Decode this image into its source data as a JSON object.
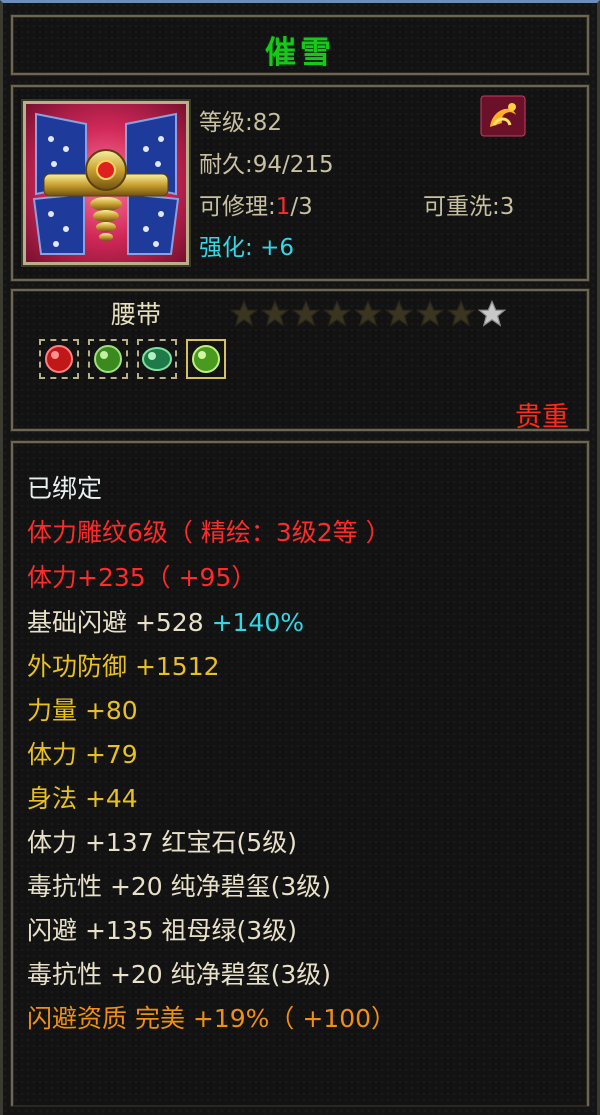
{
  "item": {
    "name": "催雪",
    "level_text": "等级:82",
    "durability_text": "耐久:94/215",
    "repair_label": "可修理:",
    "repair_used": "1",
    "repair_total": "/3",
    "rewash_text": "可重洗:3",
    "enhance_label": "强化: ",
    "enhance_value": "+6",
    "type": "腰带",
    "stars_total": 9,
    "stars_filled": 8,
    "rarity": "贵重"
  },
  "icons": {
    "item": "belt-item-icon",
    "skill": "skill-swirl-icon",
    "gems": [
      "red-gem-icon",
      "green-gem-icon",
      "green-gem-icon",
      "green-gem-icon"
    ]
  },
  "attributes": {
    "bound": "已绑定",
    "carve": "体力雕纹6级（ 精绘：3级2等 ）",
    "stamina_bonus": "体力+235（ +95）",
    "dodge_base_label": "基础闪避  +528",
    "dodge_base_pct": " +140%",
    "ext_defense": "外功防御  +1512",
    "strength": "力量  +80",
    "stamina": "体力  +79",
    "agility": "身法  +44",
    "gem_stat_1": "体力  +137  红宝石(5级)",
    "gem_stat_2": "毒抗性  +20  纯净碧玺(3级)",
    "gem_stat_3": "闪避  +135  祖母绿(3级)",
    "gem_stat_4": "毒抗性  +20  纯净碧玺(3级)",
    "aptitude": "闪避资质    完美  +19%（ +100）"
  },
  "colors": {
    "title": "#18c818",
    "label": "#c8c0a0",
    "cyan": "#30d8e8",
    "red": "#ff2a2a",
    "gold": "#e8c020",
    "white": "#e8f0f0",
    "orange": "#f09010",
    "star_filled": "#3a3520",
    "star_empty": "#c8c8c8"
  }
}
